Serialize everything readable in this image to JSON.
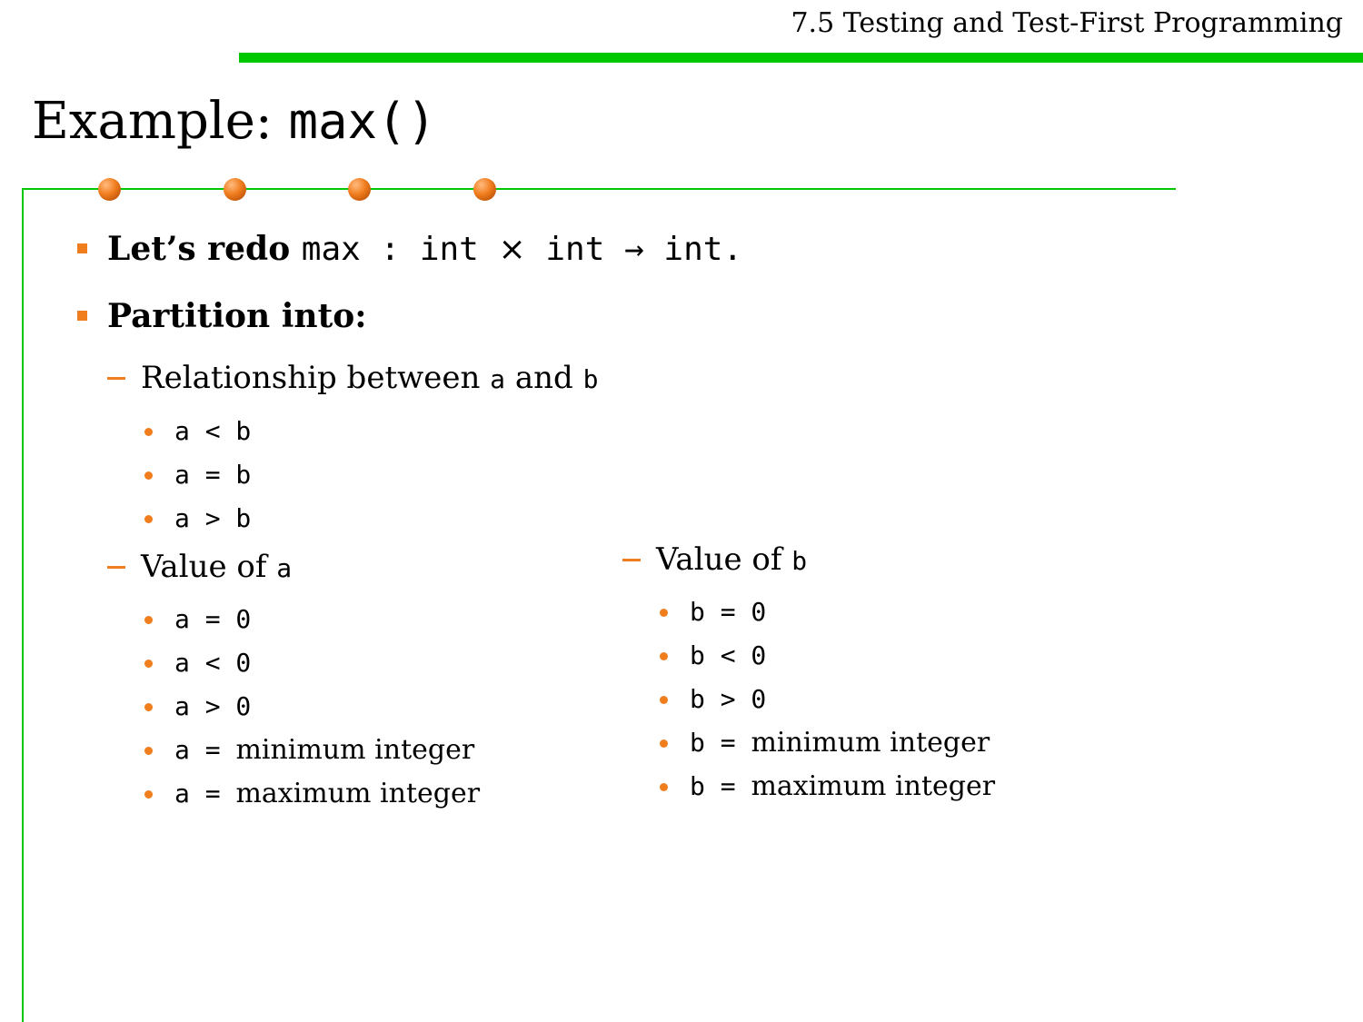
{
  "header": {
    "title": "7.5 Testing and Test-First Programming"
  },
  "slide_title": {
    "text": "Example: ",
    "code": "max()"
  },
  "bullets": {
    "b1": {
      "text": "Let’s redo ",
      "code1": "max : int ",
      "times": "×",
      "code2": " int → int."
    },
    "b2": {
      "text": "Partition into:"
    }
  },
  "relationship": {
    "label_pre": "Relationship between ",
    "var_a": "a",
    "label_mid": " and ",
    "var_b": "b",
    "items": [
      "a < b",
      "a = b",
      "a > b"
    ]
  },
  "value_a": {
    "label": "Value of ",
    "var": "a",
    "items": [
      "a = 0",
      "a < 0",
      "a > 0"
    ],
    "min_code": "a = ",
    "min_text": "minimum integer",
    "max_code": "a = ",
    "max_text": "maximum integer"
  },
  "value_b": {
    "label": "Value of ",
    "var": "b",
    "items": [
      "b = 0",
      "b < 0",
      "b > 0"
    ],
    "min_code": "b = ",
    "min_text": "minimum integer",
    "max_code": "b = ",
    "max_text": "maximum integer"
  },
  "colors": {
    "accent_green": "#00c800",
    "accent_orange": "#f07d1e"
  }
}
